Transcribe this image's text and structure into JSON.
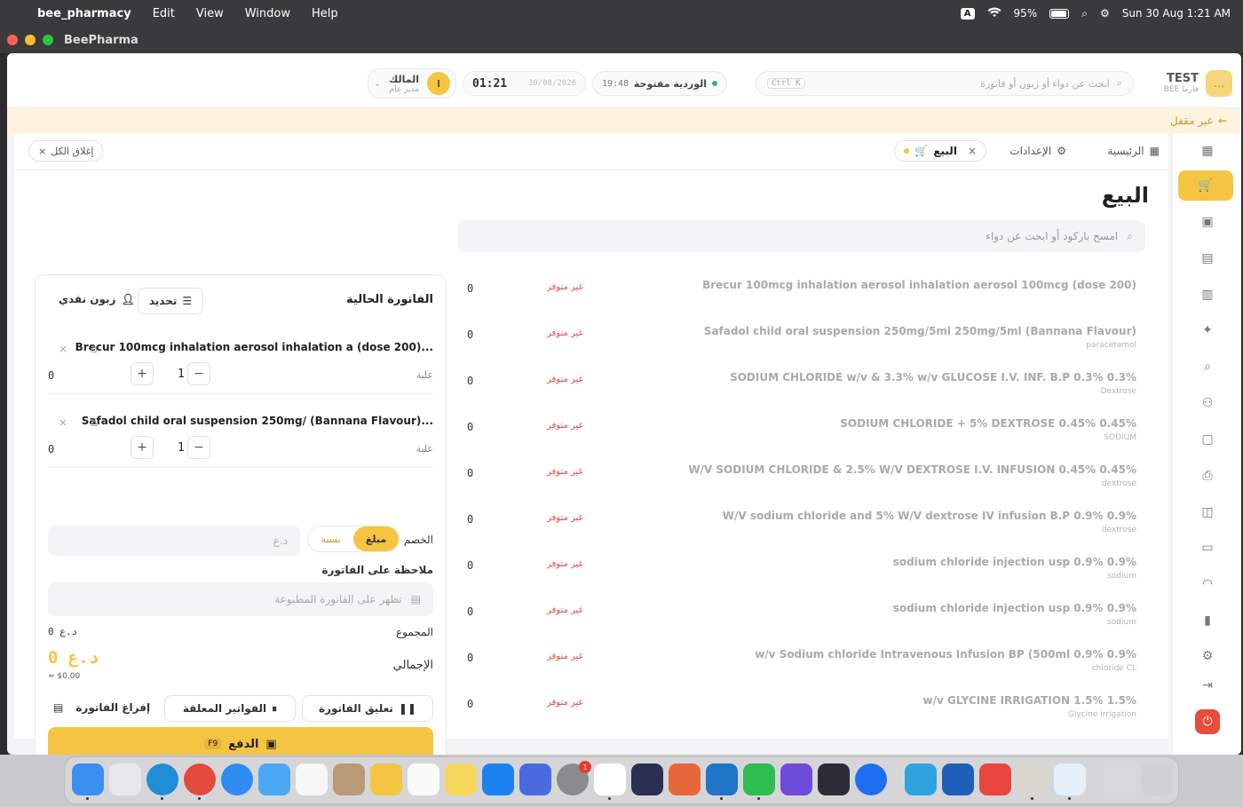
{
  "menubar": {
    "app": "bee_pharmacy",
    "items": [
      "Edit",
      "View",
      "Window",
      "Help"
    ],
    "input_source": "A",
    "battery": "95%",
    "datetime": "Sun 30 Aug  1:21 AM"
  },
  "window": {
    "title": "BeePharma"
  },
  "topbar": {
    "brand_name": "TEST",
    "brand_sub": "BEE فارما",
    "search_placeholder": "ابحث عن دواء أو زبون أو فاتورة",
    "search_shortcut": "Ctrl K",
    "shift_label": "الوردية مفتوحة",
    "shift_time": "19:48",
    "clock": "01:21",
    "date": "30/08/2026",
    "user_name": "المالك",
    "user_role": "مدير عام",
    "user_initial": "I"
  },
  "banner": {
    "text": "غير مقفل"
  },
  "tabs": {
    "home": "الرئيسية",
    "settings": "الإعدادات",
    "sale": "البيع",
    "close_all": "إغلاق الكل"
  },
  "page": {
    "title": "البيع",
    "search_placeholder": "امسح باركود أو ابحث عن دواء"
  },
  "products": [
    {
      "name": "Brecur 100mcg inhalation aerosol inhalation aerosol 100mcg (dose 200)",
      "sub": "",
      "status": "غير متوفر",
      "qty": "0"
    },
    {
      "name": "Safadol child oral suspension 250mg/5ml 250mg/5ml (Bannana Flavour)",
      "sub": "paracetamol",
      "status": "غير متوفر",
      "qty": "0"
    },
    {
      "name": "SODIUM CHLORIDE w/v & 3.3% w/v GLUCOSE I.V. INF. B.P 0.3% 0.3%",
      "sub": "Dextrose",
      "status": "غير متوفر",
      "qty": "0"
    },
    {
      "name": "SODIUM CHLORIDE + 5% DEXTROSE 0.45% 0.45%",
      "sub": "SODIUM",
      "status": "غير متوفر",
      "qty": "0"
    },
    {
      "name": "W/V SODIUM CHLORIDE & 2.5% W/V DEXTROSE I.V. INFUSION 0.45% 0.45%",
      "sub": "dextrose",
      "status": "غير متوفر",
      "qty": "0"
    },
    {
      "name": "W/V sodium chloride and 5% W/V dextrose IV infusion B.P 0.9% 0.9%",
      "sub": "dextrose",
      "status": "غير متوفر",
      "qty": "0"
    },
    {
      "name": "sodium chloride injection usp 0.9% 0.9%",
      "sub": "sodium",
      "status": "غير متوفر",
      "qty": "0"
    },
    {
      "name": "sodium chloride injection usp 0.9% 0.9%",
      "sub": "sodium",
      "status": "غير متوفر",
      "qty": "0"
    },
    {
      "name": "w/v Sodium chloride Intravenous Infusion BP (500ml 0.9% 0.9%",
      "sub": "chloride CL",
      "status": "غير متوفر",
      "qty": "0"
    },
    {
      "name": "w/v GLYCINE IRRIGATION 1.5% 1.5%",
      "sub": "Glycine irrigation",
      "status": "غير متوفر",
      "qty": "0"
    }
  ],
  "invoice": {
    "title": "الفاتورة الحالية",
    "select_label": "تحديد",
    "customer_label": "زبون نقدي",
    "items": [
      {
        "name": "Brecur 100mcg inhalation aerosol inhalation a (dose 200)...",
        "unit": "علبة",
        "qty": "1",
        "price": "0"
      },
      {
        "name": "Safadol child oral suspension 250mg/ (Bannana Flavour)...",
        "unit": "علبة",
        "qty": "1",
        "price": "0"
      }
    ],
    "discount_label": "الخصم",
    "discount_amount": "مبلغ",
    "discount_percent": "نسبة",
    "discount_placeholder": "د.ع",
    "note_label": "ملاحظة على الفاتورة",
    "note_placeholder": "تظهر على الفاتورة المطبوعة",
    "subtotal_label": "المجموع",
    "subtotal_value": "0 د.ع",
    "total_label": "الإجمالي",
    "total_value": "0 د.ع",
    "total_usd": "≈ $0.00",
    "suspend_label": "تعليق الفاتورة",
    "suspended_label": "الفواتير المعلقة",
    "clear_label": "إفراغ الفاتورة",
    "pay_label": "الدفع",
    "pay_shortcut": "F9"
  },
  "dock": {
    "settings_badge": "1"
  },
  "colors": {
    "accent": "#f5c542",
    "danger": "#e24b4b",
    "banner_bg": "#fdf3de"
  }
}
